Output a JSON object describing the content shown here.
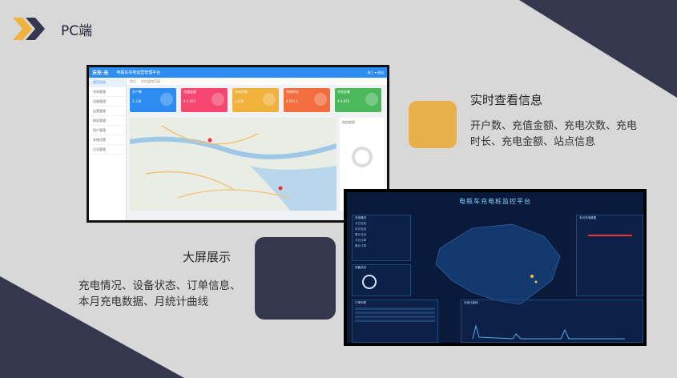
{
  "header": {
    "title": "PC端"
  },
  "pc": {
    "logo": "沃车·充",
    "app_title": "电瓶车充电运营管理平台",
    "top_right": "张三  ▾  退出",
    "tabs": [
      "首页",
      "实时监控页面"
    ],
    "sidebar": [
      "首页总览",
      "充电管理",
      "设备管理",
      "运营管理",
      "财务管理",
      "用户管理",
      "系统设置",
      "日志管理"
    ],
    "cards": [
      {
        "title": "开户数",
        "value": "2,148",
        "color": "#2d8cf0"
      },
      {
        "title": "充值金额",
        "value": "¥ 1,052",
        "color": "#f5476f"
      },
      {
        "title": "充电次数",
        "value": "4,026",
        "color": "#f0b23a"
      },
      {
        "title": "充电时长",
        "value": "8,563 h",
        "color": "#f26e3f"
      },
      {
        "title": "充电金额",
        "value": "¥ 9,870",
        "color": "#4cb85c"
      }
    ],
    "panel_title": "站点信息"
  },
  "bigscreen": {
    "title": "电瓶车充电桩监控平台",
    "left_title": "充电情况",
    "left_rows": [
      "今日充电",
      "本月充电",
      "累计充电",
      "今日订单",
      "累计订单"
    ],
    "device_title": "设备状态",
    "order_title": "订单列表",
    "chart_title": "月统计曲线",
    "right_title": "本月充电数据"
  },
  "features": {
    "right": {
      "title": "实时查看信息",
      "desc": "开户数、充值金额、充电次数、充电时长、充电金额、站点信息",
      "color": "#e8b04a"
    },
    "left": {
      "title": "大屏展示",
      "desc": "充电情况、设备状态、订单信息、本月充电数据、月统计曲线",
      "color": "#35374f"
    }
  }
}
